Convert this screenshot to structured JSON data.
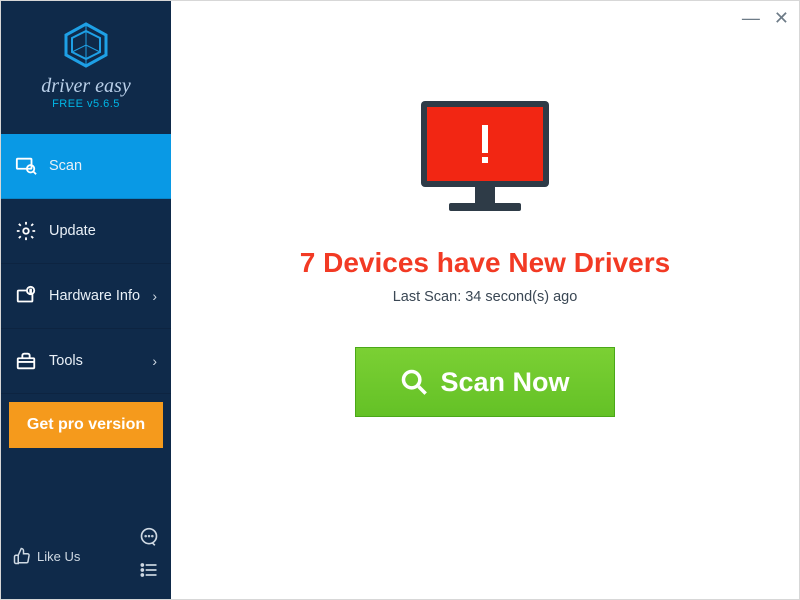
{
  "brand": {
    "name": "driver easy",
    "version": "FREE v5.6.5"
  },
  "sidebar": {
    "items": [
      {
        "label": "Scan"
      },
      {
        "label": "Update"
      },
      {
        "label": "Hardware Info"
      },
      {
        "label": "Tools"
      }
    ],
    "pro_label": "Get pro version",
    "like_label": "Like Us"
  },
  "main": {
    "headline": "7 Devices have New Drivers",
    "last_scan": "Last Scan: 34 second(s) ago",
    "scan_button": "Scan Now"
  },
  "colors": {
    "accent": "#0999e5",
    "sidebar_bg": "#0f2a4a",
    "pro_bg": "#f59a1c",
    "alert_red": "#f23a24",
    "scan_green": "#6fc62b"
  }
}
